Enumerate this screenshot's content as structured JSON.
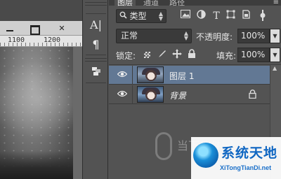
{
  "document_window": {
    "window_controls": {
      "minimize": "—",
      "maximize": "□",
      "close": "✕"
    },
    "ruler": {
      "labels": [
        "1100",
        "1200"
      ]
    }
  },
  "tool_column": {
    "icons": [
      "character-icon",
      "paragraph-icon",
      "3d-layers-icon"
    ],
    "character_glyph": "A|",
    "paragraph_glyph": "¶"
  },
  "layers_panel": {
    "tabs": [
      "图层",
      "通道",
      "路径"
    ],
    "menu_glyph": "≡",
    "filter": {
      "kind_label": "类型",
      "search_glyph": "🔍"
    },
    "blend_mode": "正常",
    "opacity_label": "不透明度:",
    "opacity_value": "100%",
    "lock_label": "锁定:",
    "fill_label": "填充:",
    "fill_value": "100%",
    "layers": [
      {
        "name": "图层 1",
        "selected": true,
        "visible": true,
        "locked": false
      },
      {
        "name": "背景",
        "selected": false,
        "visible": true,
        "locked": true
      }
    ]
  },
  "watermark": {
    "left_text": "当下软件园",
    "title": "系统天地",
    "url": "XiTongTianDi.net"
  },
  "colors": {
    "panel_bg": "#535353",
    "selected_layer": "#627894",
    "field_bg": "#3a3a3a",
    "watermark_blue": "#0f66c2"
  }
}
